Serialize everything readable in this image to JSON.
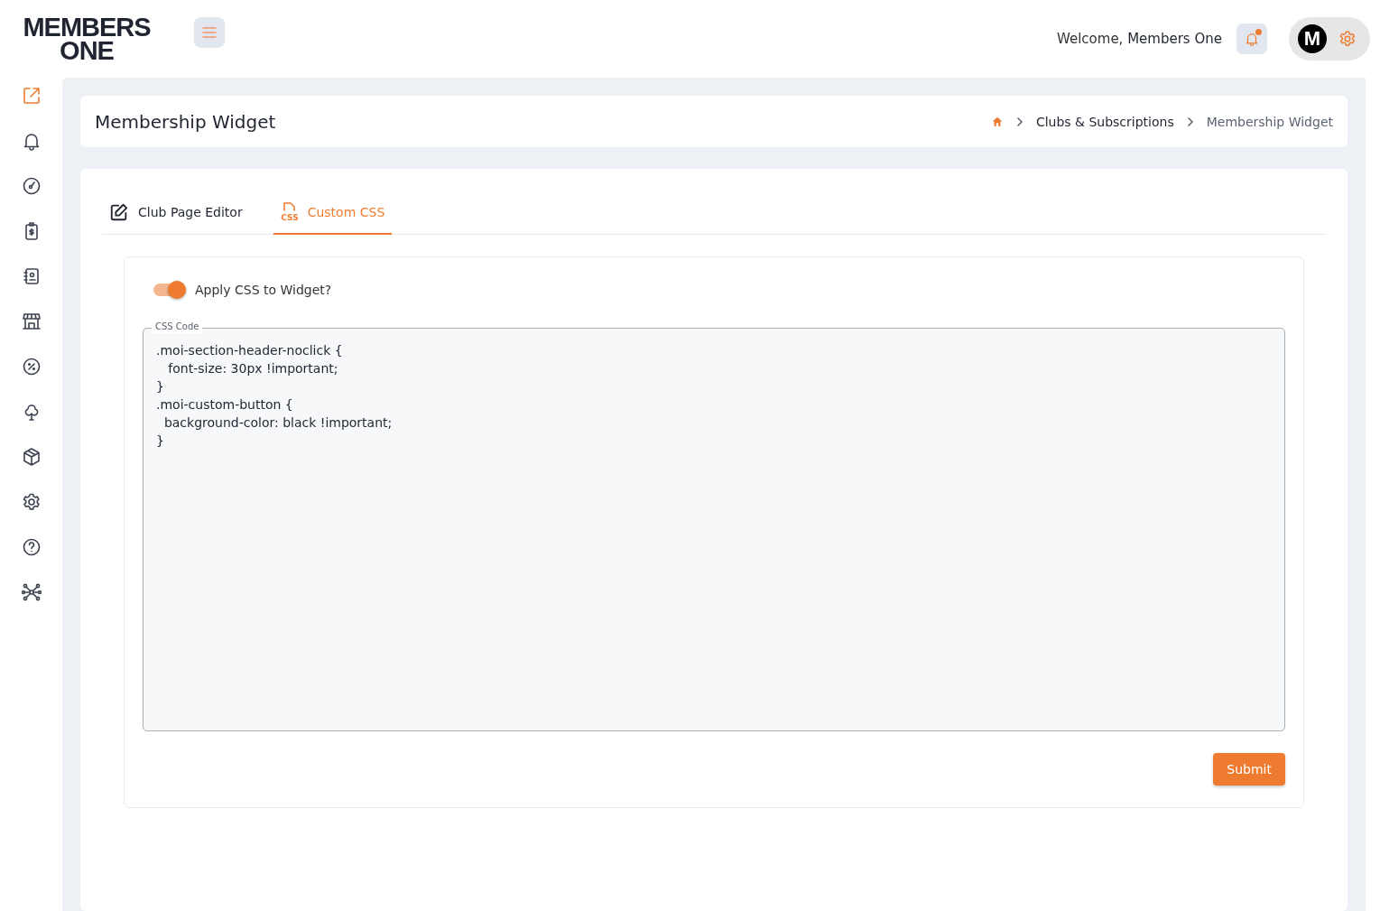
{
  "logo": {
    "line_1": "MEMBERS",
    "line_2": "ONE"
  },
  "header": {
    "welcome": "Welcome,",
    "user_name": "Members One",
    "avatar_letter": "M",
    "notification_unread": true
  },
  "sidebar": {
    "items": [
      {
        "selected": true
      },
      {
        "selected": false
      },
      {
        "selected": false
      },
      {
        "selected": false
      },
      {
        "selected": false
      },
      {
        "selected": false
      },
      {
        "selected": false
      },
      {
        "selected": false
      },
      {
        "selected": false
      },
      {
        "selected": false
      },
      {
        "selected": false
      },
      {
        "selected": false
      }
    ]
  },
  "page": {
    "title": "Membership Widget",
    "breadcrumb": [
      "Clubs & Subscriptions",
      "Membership Widget"
    ]
  },
  "tabs": [
    {
      "label": "Club Page Editor",
      "selected": false
    },
    {
      "label": "Custom CSS",
      "icon_text": "CSS",
      "selected": true
    }
  ],
  "apply_css": {
    "label": "Apply CSS to Widget?",
    "on": true
  },
  "css_code": {
    "label": "CSS Code",
    "value": ".moi-section-header-noclick {\n   font-size: 30px !important;\n}\n.moi-custom-button {\n  background-color: black !important;\n}"
  },
  "submit": "Submit"
}
